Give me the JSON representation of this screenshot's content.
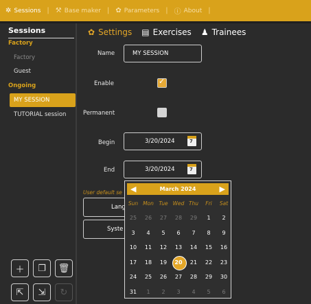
{
  "topbar": {
    "items": [
      {
        "label": "Sessions",
        "icon": "gears-icon"
      },
      {
        "label": "Base maker",
        "icon": "wrench-icon"
      },
      {
        "label": "Parameters",
        "icon": "gear-icon"
      },
      {
        "label": "About",
        "icon": "info-icon"
      }
    ],
    "separator": "|"
  },
  "sidebar": {
    "title": "Sessions",
    "groups": {
      "factory": "Factory",
      "ongoing": "Ongoing"
    },
    "items": [
      {
        "label": "Factory"
      },
      {
        "label": "Guest"
      },
      {
        "label": "MY SESSION"
      },
      {
        "label": "TUTORIAL session"
      }
    ]
  },
  "tabs": [
    {
      "label": "Settings",
      "icon": "gear-icon"
    },
    {
      "label": "Exercises",
      "icon": "clipboard-icon"
    },
    {
      "label": "Trainees",
      "icon": "user-icon"
    }
  ],
  "form": {
    "name_label": "Name",
    "name_value": "MY SESSION",
    "enable_label": "Enable",
    "enable_checked": true,
    "permanent_label": "Permanent",
    "permanent_checked": false,
    "begin_label": "Begin",
    "begin_value": "3/20/2024",
    "end_label": "End",
    "end_value": "3/20/2024",
    "calendar_icon_day": "7",
    "hint_text": "User default se",
    "language_button": "Lang",
    "system_button": "Syste"
  },
  "datepicker": {
    "month_label": "March 2024",
    "prev": "◀",
    "next": "▶",
    "weekdays": [
      "Sun",
      "Mon",
      "Tue",
      "Wed",
      "Thu",
      "Fri",
      "Sat"
    ],
    "weeks": [
      [
        "25",
        "26",
        "27",
        "28",
        "29",
        "1",
        "2"
      ],
      [
        "3",
        "4",
        "5",
        "6",
        "7",
        "8",
        "9"
      ],
      [
        "10",
        "11",
        "12",
        "13",
        "14",
        "15",
        "16"
      ],
      [
        "17",
        "18",
        "19",
        "20",
        "21",
        "22",
        "23"
      ],
      [
        "24",
        "25",
        "26",
        "27",
        "28",
        "29",
        "30"
      ],
      [
        "31",
        "1",
        "2",
        "3",
        "4",
        "5",
        "6"
      ]
    ],
    "selected": "20"
  },
  "colors": {
    "accent": "#d9a21b",
    "background": "#2b2b2b"
  }
}
